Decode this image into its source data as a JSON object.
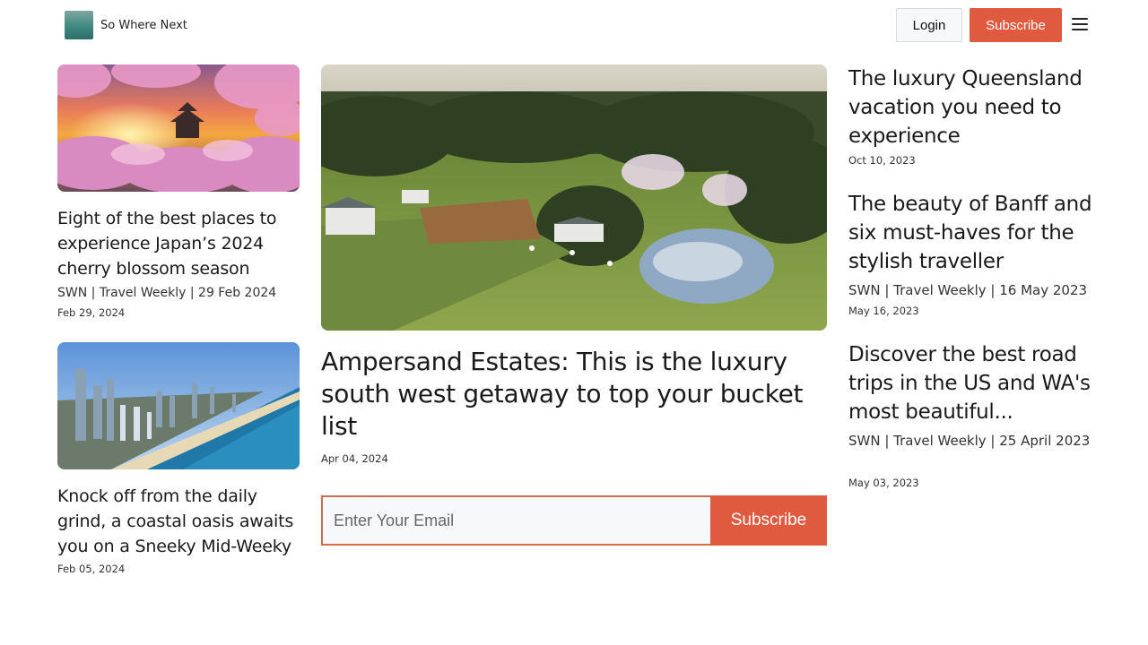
{
  "header": {
    "brand": "So Where Next",
    "login_label": "Login",
    "subscribe_label": "Subscribe",
    "logo_icon": "site-logo",
    "menu_icon": "hamburger-menu-icon"
  },
  "left": {
    "articles": [
      {
        "title": "Eight of the best places to experience Japan’s 2024 cherry blossom season",
        "meta": "SWN | Travel Weekly | 29 Feb 2024",
        "date": "Feb 29, 2024"
      },
      {
        "title": "Knock off from the daily grind, a coastal oasis awaits you on a Sneeky Mid-Weeky",
        "date": "Feb 05, 2024"
      }
    ]
  },
  "main": {
    "title": "Ampersand Estates: This is the luxury south west getaway to top your bucket list",
    "date": "Apr 04, 2024",
    "email_placeholder": "Enter Your Email",
    "subscribe_label": "Subscribe"
  },
  "right": {
    "articles": [
      {
        "title": "The luxury Queensland vacation you need to experience",
        "date": "Oct 10, 2023"
      },
      {
        "title": "The beauty of Banff and six must-haves for the stylish traveller",
        "meta": "SWN | Travel Weekly | 16 May 2023",
        "date": "May 16, 2023"
      },
      {
        "title": "Discover the best road trips in the US and WA's most beautiful...",
        "meta": "SWN | Travel Weekly | 25 April 2023",
        "date": "May 03, 2023"
      }
    ]
  },
  "colors": {
    "accent": "#e05a3f",
    "text": "#1a1a1a"
  }
}
